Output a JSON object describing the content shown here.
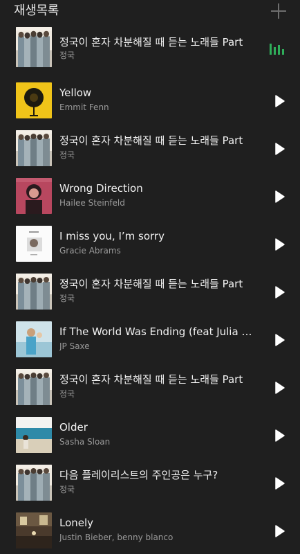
{
  "header": {
    "title": "재생목록",
    "add_icon": "plus-icon"
  },
  "colors": {
    "background": "#1f1f1f",
    "title_text": "#f2f2f2",
    "subtitle_text": "#9a9a9a",
    "now_playing_accent": "#2fae5a"
  },
  "playlist": [
    {
      "title": "정국이 혼자 차분해질 때 듣는 노래들 Part",
      "artist": "정국",
      "art": "group",
      "now_playing": true
    },
    {
      "title": "Yellow",
      "artist": "Emmit Fenn",
      "art": "yellow"
    },
    {
      "title": "정국이 혼자 차분해질 때 듣는 노래들 Part",
      "artist": "정국",
      "art": "group"
    },
    {
      "title": "Wrong Direction",
      "artist": "Hailee Steinfeld",
      "art": "pink"
    },
    {
      "title": "I miss you, I’m sorry",
      "artist": "Gracie Abrams",
      "art": "white"
    },
    {
      "title": "정국이 혼자 차분해질 때 듣는 노래들 Part",
      "artist": "정국",
      "art": "group"
    },
    {
      "title": "If The World Was Ending (feat Julia Michaels)",
      "artist": "JP Saxe",
      "art": "blue"
    },
    {
      "title": "정국이 혼자 차분해질 때 듣는 노래들 Part",
      "artist": "정국",
      "art": "group"
    },
    {
      "title": "Older",
      "artist": "Sasha Sloan",
      "art": "beach"
    },
    {
      "title": "다음 플레이리스트의 주인공은 누구?",
      "artist": "정국",
      "art": "group"
    },
    {
      "title": "Lonely",
      "artist": "Justin Bieber, benny blanco",
      "art": "room"
    }
  ]
}
